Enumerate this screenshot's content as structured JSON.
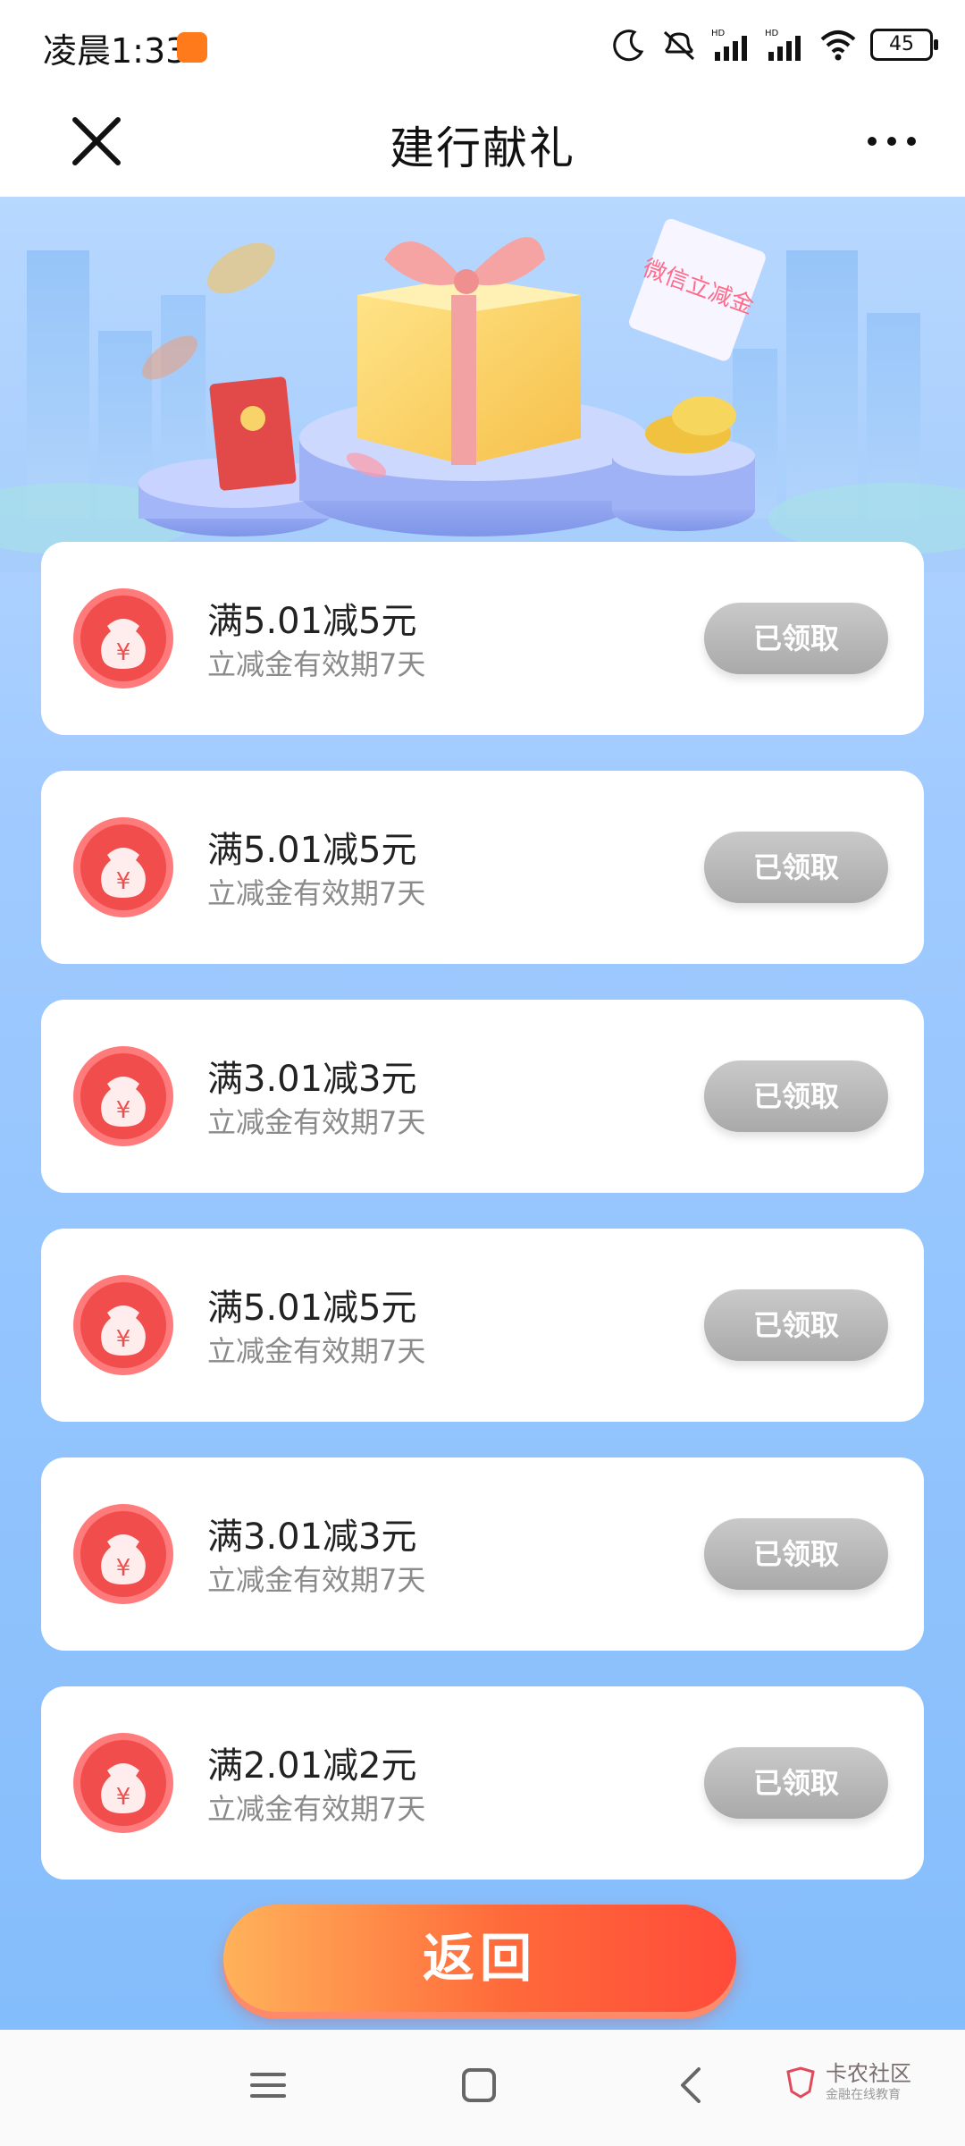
{
  "status": {
    "time": "凌晨1:33",
    "battery": "45"
  },
  "header": {
    "title": "建行献礼"
  },
  "banner": {
    "coupon_label": "微信立减金"
  },
  "coupons": [
    {
      "title": "满5.01减5元",
      "subtitle": "立减金有效期7天",
      "button": "已领取"
    },
    {
      "title": "满5.01减5元",
      "subtitle": "立减金有效期7天",
      "button": "已领取"
    },
    {
      "title": "满3.01减3元",
      "subtitle": "立减金有效期7天",
      "button": "已领取"
    },
    {
      "title": "满5.01减5元",
      "subtitle": "立减金有效期7天",
      "button": "已领取"
    },
    {
      "title": "满3.01减3元",
      "subtitle": "立减金有效期7天",
      "button": "已领取"
    },
    {
      "title": "满2.01减2元",
      "subtitle": "立减金有效期7天",
      "button": "已领取"
    }
  ],
  "return_button": "返回",
  "watermark": {
    "main": "卡农社区",
    "sub": "金融在线教育"
  },
  "colors": {
    "accent": "#ff5a3a",
    "bag": "#f25a5a",
    "claimed": "#b5b5b5"
  }
}
